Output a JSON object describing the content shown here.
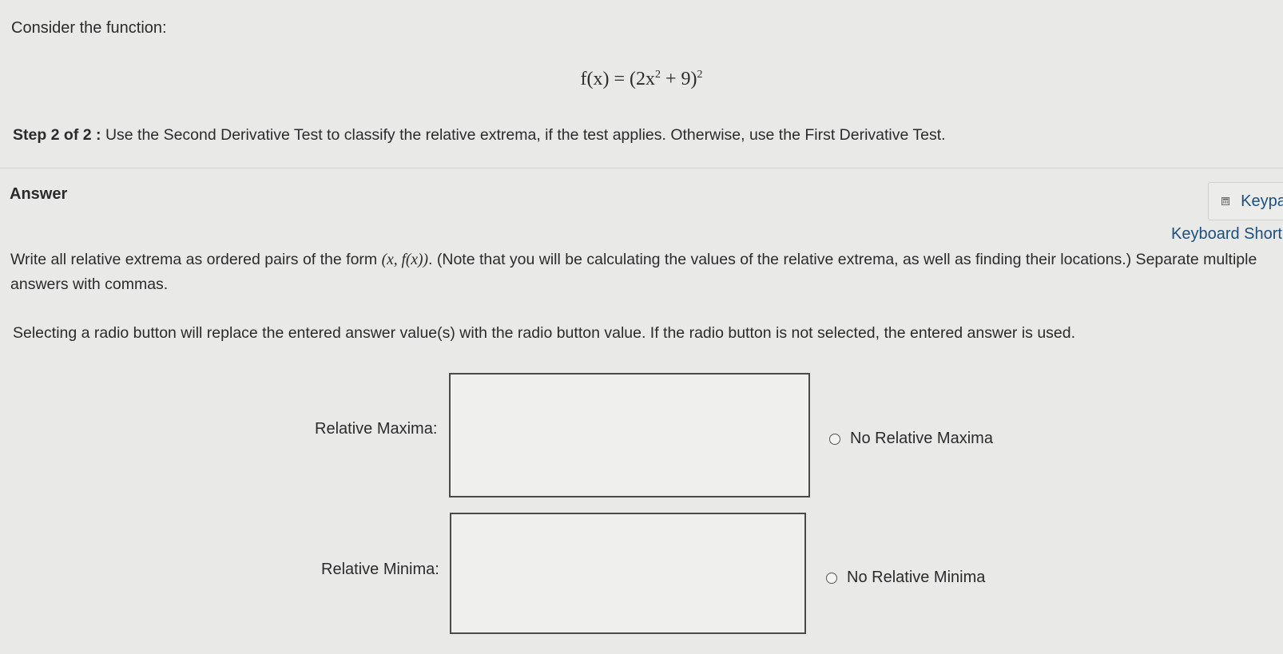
{
  "question": {
    "prompt": "Consider the function:",
    "function_lhs": "f(x) = ",
    "function_base": "(2x",
    "function_inner_exp": "2",
    "function_inner_rest": " + 9)",
    "function_outer_exp": "2",
    "step_label": "Step 2 of 2 :",
    "step_text": " Use the Second Derivative Test to classify the relative extrema, if the test applies. Otherwise, use the First Derivative Test."
  },
  "answer": {
    "heading": "Answer",
    "keypad_label": "Keypad",
    "keyboard_shortcuts_label": "Keyboard Shortcuts",
    "instructions_part1": "Write all relative extrema as ordered pairs of the form ",
    "ordered_pair": "(x, f(x))",
    "instructions_part2": ". (Note that you will be calculating the values of the relative extrema, as well as finding their locations.) Separate multiple answers with commas.",
    "radio_note": "Selecting a radio button will replace the entered answer value(s) with the radio button value. If the radio button is not selected, the entered answer is used.",
    "maxima": {
      "label": "Relative Maxima:",
      "value": "",
      "radio_label": "No Relative Maxima"
    },
    "minima": {
      "label": "Relative Minima:",
      "value": "",
      "radio_label": "No Relative Minima"
    }
  }
}
